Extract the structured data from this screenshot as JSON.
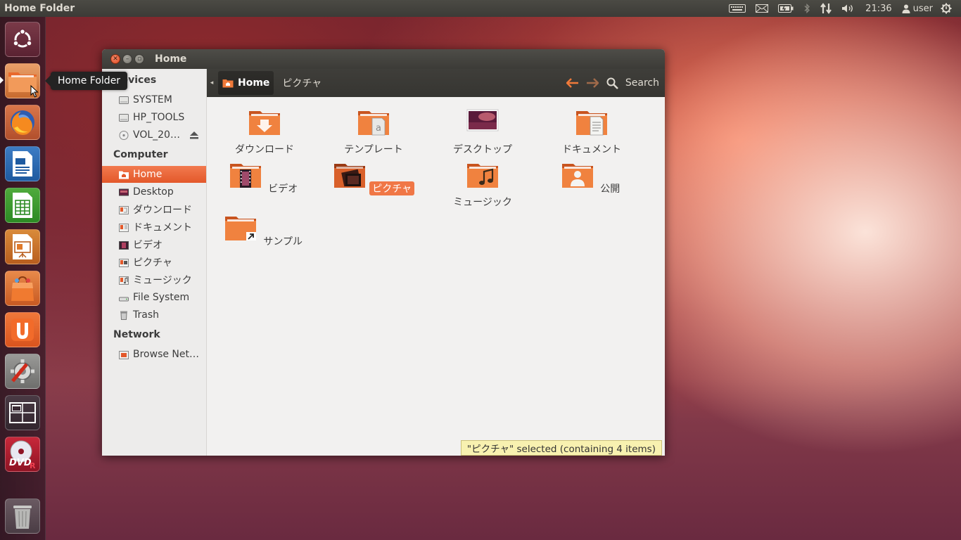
{
  "top_panel": {
    "title": "Home Folder",
    "clock": "21:36",
    "user": "user",
    "indicators": [
      "keyboard-icon",
      "mail-icon",
      "battery-icon",
      "bluetooth-icon",
      "network-icon",
      "volume-icon"
    ]
  },
  "launcher": {
    "tooltip": "Home Folder",
    "items": [
      "dash-home",
      "home-folder",
      "firefox",
      "libreoffice-writer",
      "libreoffice-calc",
      "libreoffice-impress",
      "ubuntu-software-center",
      "ubuntu-one",
      "system-settings",
      "workspace-switcher",
      "dvd-burner",
      "trash"
    ]
  },
  "window": {
    "title": "Home",
    "toolbar": {
      "crumb_home": "Home",
      "crumb_next": "ピクチャ",
      "search_label": "Search"
    },
    "sidebar": {
      "devices_heading": "Devices",
      "devices": [
        "SYSTEM",
        "HP_TOOLS",
        "VOL_20…"
      ],
      "computer_heading": "Computer",
      "computer": [
        "Home",
        "Desktop",
        "ダウンロード",
        "ドキュメント",
        "ビデオ",
        "ピクチャ",
        "ミュージック",
        "File System",
        "Trash"
      ],
      "network_heading": "Network",
      "network": [
        "Browse Net…"
      ]
    },
    "files": [
      "ダウンロード",
      "テンプレート",
      "デスクトップ",
      "ドキュメント",
      "ビデオ",
      "ピクチャ",
      "ミュージック",
      "公開",
      "サンプル"
    ],
    "status": "\"ピクチャ\" selected (containing 4 items)"
  },
  "colors": {
    "accent": "#e95420",
    "panel": "#3c3b37",
    "selection": "#f07746"
  }
}
